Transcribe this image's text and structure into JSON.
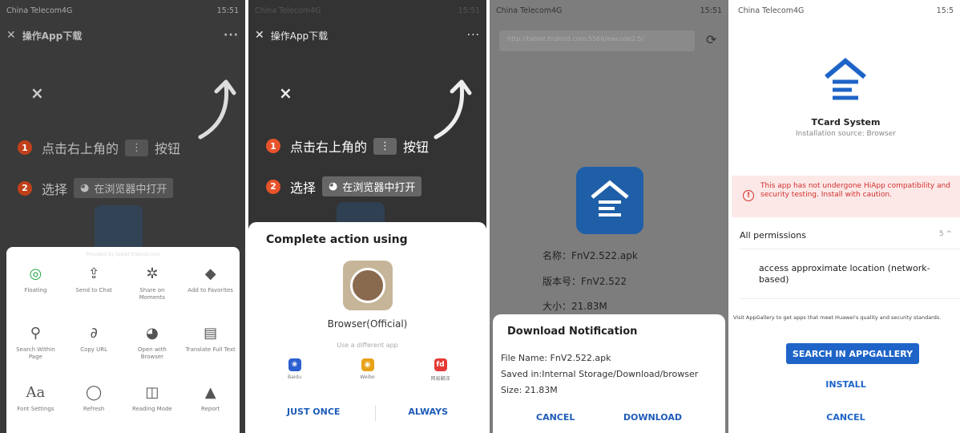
{
  "status": {
    "carrier": "China Telecom4G",
    "time": "15:51",
    "time4": "15:5"
  },
  "guide": {
    "title": "操作App下载",
    "menu": "···",
    "close": "×",
    "step1_num": "1",
    "step1_a": "点击右上角的",
    "step1_chip": "⋮",
    "step1_b": "按钮",
    "step2_num": "2",
    "step2_a": "选择",
    "step2_chip": "在浏览器中打开"
  },
  "share_sheet": {
    "provider": "Provided by tablet.fndroid.com",
    "items": [
      {
        "label": "Floating",
        "icon": "floating-icon"
      },
      {
        "label": "Send to Chat",
        "icon": "send-icon"
      },
      {
        "label": "Share on Moments",
        "icon": "moments-icon"
      },
      {
        "label": "Add to Favorites",
        "icon": "favorites-icon"
      },
      {
        "label": "Search Within Page",
        "icon": "search-icon"
      },
      {
        "label": "Copy URL",
        "icon": "link-icon"
      },
      {
        "label": "Open with Browser",
        "icon": "globe-icon"
      },
      {
        "label": "Translate Full Text",
        "icon": "document-icon"
      },
      {
        "label": "Font Settings",
        "icon": "font-icon"
      },
      {
        "label": "Refresh",
        "icon": "refresh-icon"
      },
      {
        "label": "Reading Mode",
        "icon": "book-icon"
      },
      {
        "label": "Report",
        "icon": "warning-icon"
      }
    ]
  },
  "complete_action": {
    "title": "Complete action using",
    "browser": "Browser(Official)",
    "different": "Use a different app",
    "apps": [
      {
        "name": "Baidu",
        "color": "#2c5fd0",
        "glyph": "❀"
      },
      {
        "name": "Weibo",
        "color": "#e8a21a",
        "glyph": "◉"
      },
      {
        "name": "网易翻译",
        "color": "#e53935",
        "glyph": "fd"
      }
    ],
    "just_once": "JUST ONCE",
    "always": "ALWAYS"
  },
  "download": {
    "url": "http://tablet.fndroid.com:5566/ewcode2.5/",
    "name_line": "名称：FnV2.522.apk",
    "version_line": "版本号：FnV2.522",
    "size_line": "大小：21.83M",
    "dialog_title": "Download Notification",
    "file_name": "File Name: FnV2.522.apk",
    "saved_in": "Saved in:Internal Storage/Download/browser",
    "size": "Size: 21.83M",
    "cancel": "CANCEL",
    "download": "DOWNLOAD"
  },
  "install": {
    "app_name": "TCard System",
    "source": "Installation source: Browser",
    "warning": "This app has not undergone HiApp compatibility and security testing. Install with caution.",
    "all_permissions": "All permissions",
    "perm_count": "5",
    "perm_item": "access approximate location (network-based)",
    "visit": "Visit AppGallery to get apps that meet Huawei's quality and security standards.",
    "search_btn": "SEARCH IN APPGALLERY",
    "install_btn": "INSTALL",
    "cancel_btn": "CANCEL"
  },
  "colors": {
    "accent": "#1e64c8",
    "warn": "#d0312d",
    "step": "#c0401a"
  }
}
